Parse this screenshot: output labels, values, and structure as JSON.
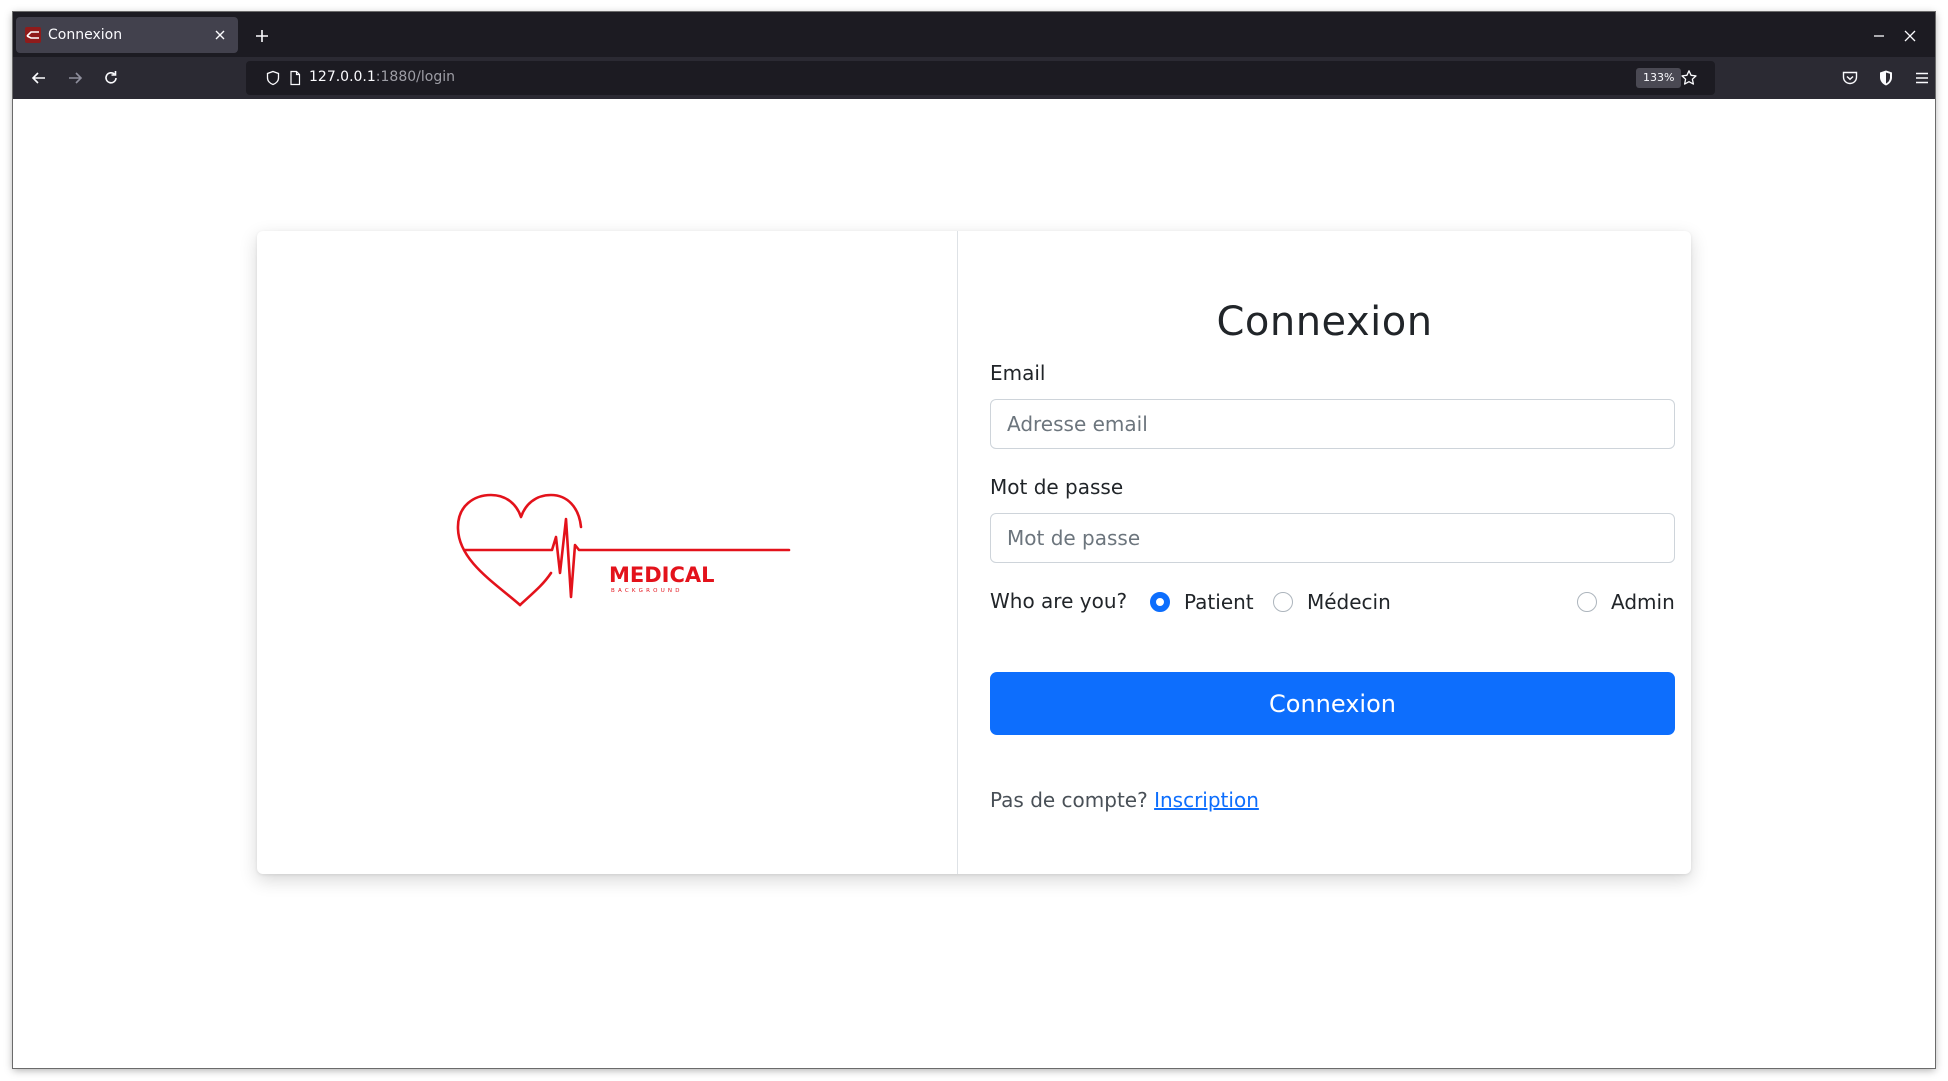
{
  "browser": {
    "tab_title": "Connexion",
    "url_host": "127.0.0.1",
    "url_path": ":1880/login",
    "zoom": "133%"
  },
  "logo": {
    "word": "MEDICAL",
    "sub": "BACKGROUND"
  },
  "login": {
    "title": "Connexion",
    "email_label": "Email",
    "email_placeholder": "Adresse email",
    "password_label": "Mot de passe",
    "password_placeholder": "Mot de passe",
    "role_prompt": "Who are you?",
    "roles": [
      {
        "label": "Patient",
        "checked": true
      },
      {
        "label": "Médecin",
        "checked": false
      },
      {
        "label": "Admin",
        "checked": false
      }
    ],
    "submit_label": "Connexion",
    "signup_text": "Pas de compte?",
    "signup_link": "Inscription"
  },
  "colors": {
    "primary": "#0d6efd",
    "logo_red": "#e3121b",
    "browser_dark": "#1c1b22"
  }
}
